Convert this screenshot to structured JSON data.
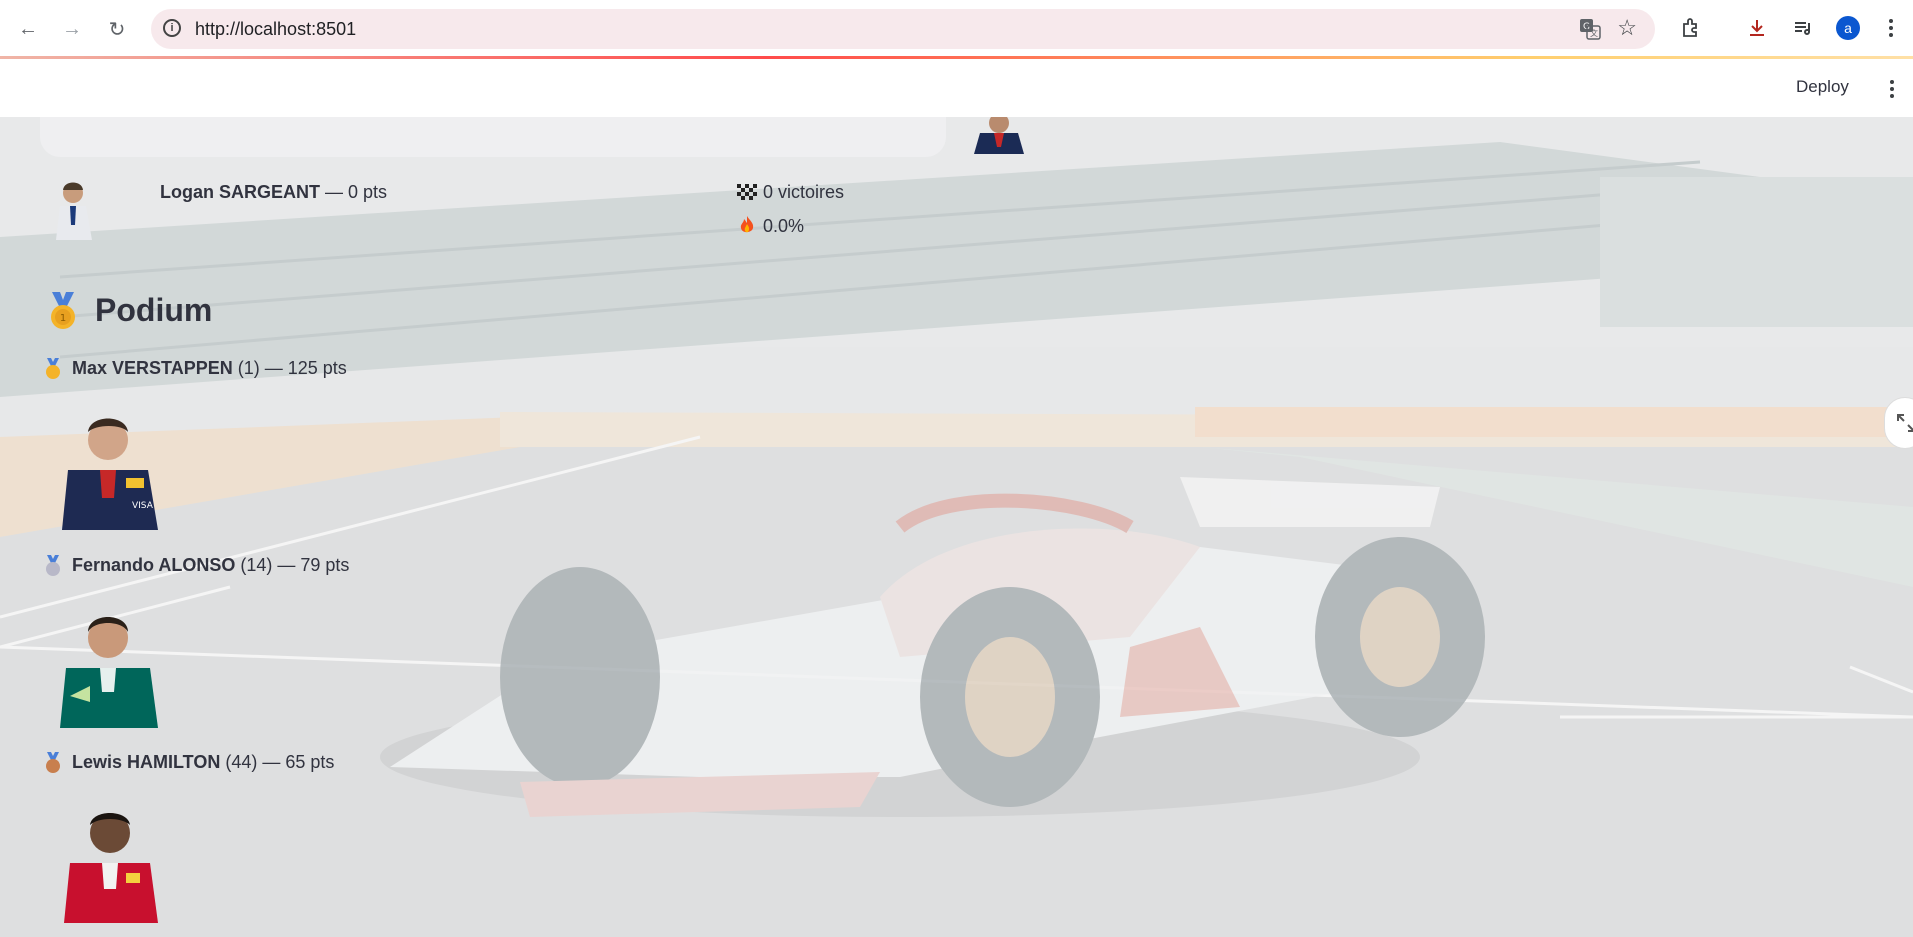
{
  "browser": {
    "url": "http://localhost:8501",
    "avatar_letter": "a"
  },
  "header": {
    "deploy_label": "Deploy"
  },
  "last_driver": {
    "name": "Logan SARGEANT",
    "points": " — 0 pts",
    "wins": "0 victoires",
    "rate": "0.0%"
  },
  "podium": {
    "title": "Podium",
    "entries": [
      {
        "name": "Max VERSTAPPEN",
        "detail": " (1) — 125 pts",
        "medal": "gold-medal"
      },
      {
        "name": "Fernando ALONSO",
        "detail": " (14) — 79 pts",
        "medal": "silver-medal"
      },
      {
        "name": "Lewis HAMILTON",
        "detail": " (44) — 65 pts",
        "medal": "bronze-medal"
      }
    ]
  },
  "colors": {
    "gold": "#f4b329",
    "silver": "#b8b8c8",
    "bronze": "#c87f4e",
    "ribbon": "#4a7fd8",
    "text": "#31333f",
    "accent": "#ff4b4b"
  }
}
